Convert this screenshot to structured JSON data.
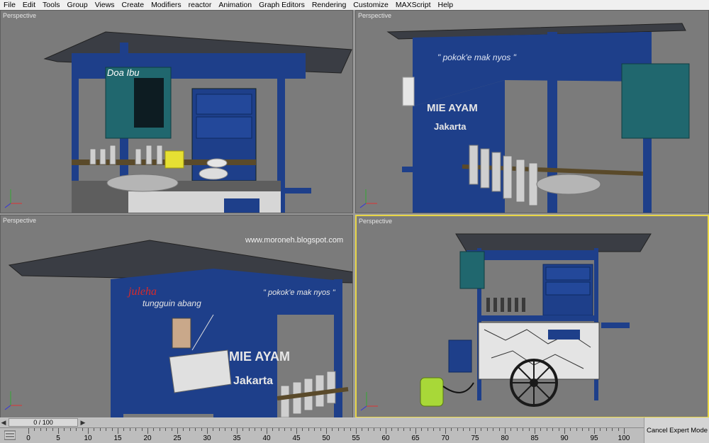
{
  "menu": [
    "File",
    "Edit",
    "Tools",
    "Group",
    "Views",
    "Create",
    "Modifiers",
    "reactor",
    "Animation",
    "Graph Editors",
    "Rendering",
    "Customize",
    "MAXScript",
    "Help"
  ],
  "viewports": [
    {
      "label": "Perspective",
      "sign": "Doa Ibu"
    },
    {
      "label": "Perspective",
      "slogan": "\" pokok'e mak nyos \"",
      "brand": "MIE AYAM",
      "city": "Jakarta"
    },
    {
      "label": "Perspective",
      "watermark": "www.moroneh.blogspot.com",
      "name": "juleha",
      "tagline": "tungguin abang",
      "slogan": "\" pokok'e mak nyos \"",
      "brand": "MIE AYAM",
      "city": "Jakarta"
    },
    {
      "label": "Perspective"
    }
  ],
  "timeline": {
    "frame": "0 / 100",
    "ticks": [
      "0",
      "5",
      "10",
      "15",
      "20",
      "25",
      "30",
      "35",
      "40",
      "45",
      "50",
      "55",
      "60",
      "65",
      "70",
      "75",
      "80",
      "85",
      "90",
      "95",
      "100"
    ]
  },
  "cancel_label": "Cancel Expert Mode",
  "colors": {
    "cart_blue": "#1e3f8a",
    "roof": "#3a3d44",
    "active_border": "#e8d646"
  }
}
